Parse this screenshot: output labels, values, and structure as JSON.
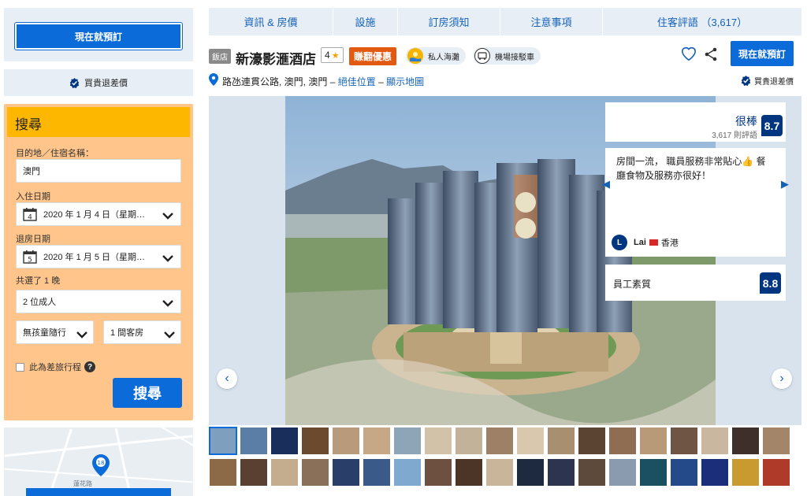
{
  "left": {
    "book_now": "現在就預訂",
    "price_guarantee": "買貴退差價",
    "search": {
      "title": "搜尋",
      "destination_label": "目的地／住宿名稱：",
      "destination_value": "澳門",
      "checkin_label": "入住日期",
      "checkin_day": "4",
      "checkin_value": "2020 年 1 月 4 日（星期…",
      "checkout_label": "退房日期",
      "checkout_day": "5",
      "checkout_value": "2020 年 1 月 5 日（星期…",
      "nights": "共選了 1 晚",
      "adults": "2 位成人",
      "children": "無孩童隨行",
      "rooms": "1 間客房",
      "business_trip": "此為差旅行程",
      "help": "?",
      "submit": "搜尋"
    },
    "map": {
      "labels": [
        "蓮花路"
      ],
      "pin": "18"
    }
  },
  "main": {
    "tabs": [
      {
        "label": "資訊 & 房價"
      },
      {
        "label": "設施"
      },
      {
        "label": "訂房須知"
      },
      {
        "label": "注意事項"
      },
      {
        "label": "住客評語 （3,617）"
      }
    ],
    "badge": "飯店",
    "hotel_name": "新濠影滙酒店",
    "stars": "4",
    "deal": "賺翻優惠",
    "amenities": [
      "私人海灘",
      "機場接駁車"
    ],
    "book_now": "現在就預訂",
    "address": "路氹連貫公路, 澳門, 澳門",
    "location_link": "絕佳位置",
    "map_link": "顯示地圖",
    "dash": "–",
    "price_guarantee": "買貴退差價",
    "review": {
      "rating_word": "很棒",
      "review_count": "3,617 則評語",
      "score": "8.7",
      "quote": "房間一流， 職員服務非常貼心👍 餐廳食物及服務亦很好！",
      "reviewer_initial": "L",
      "reviewer_name": "Lai",
      "reviewer_country": "香港",
      "category": "員工素質",
      "category_score": "8.8"
    },
    "nav": {
      "prev": "‹",
      "next": "›"
    }
  },
  "colors": {
    "primary_blue": "#0b6bd8",
    "dark_blue": "#003580",
    "link_blue": "#1462b8",
    "search_bg": "#ffc58a",
    "search_head": "#feb700",
    "deal_orange": "#e25a12",
    "panel_bg": "#e8eef6"
  }
}
